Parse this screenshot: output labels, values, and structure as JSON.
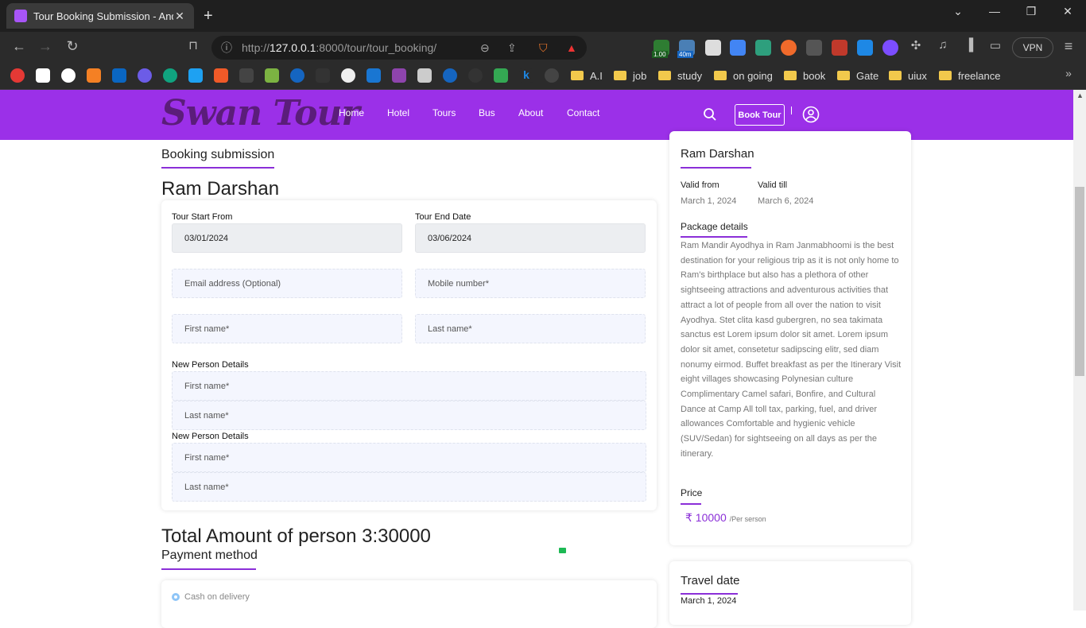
{
  "browser": {
    "tab_title": "Tour Booking Submission - Andt",
    "url_prefix": "http://",
    "url_host": "127.0.0.1",
    "url_rest": ":8000/tour/tour_booking/",
    "vpn_label": "VPN",
    "ext_badge_1": "1.00",
    "ext_badge_2": "40m",
    "bookmarks": [
      "A.I",
      "job",
      "study",
      "on going",
      "book",
      "Gate",
      "uiux",
      "freelance"
    ]
  },
  "site": {
    "logo": "Swan Tour",
    "nav": [
      "Home",
      "Hotel",
      "Tours",
      "Bus",
      "About",
      "Contact"
    ],
    "book_button": "Book Tour"
  },
  "main": {
    "section_title": "Booking submission",
    "tour_name": "Ram Darshan",
    "start_label": "Tour Start From",
    "start_value": "03/01/2024",
    "end_label": "Tour End Date",
    "end_value": "03/06/2024",
    "email_placeholder": "Email address (Optional)",
    "mobile_placeholder": "Mobile number*",
    "first_placeholder": "First name*",
    "last_placeholder": "Last name*",
    "new_person_label": "New Person Details",
    "total": "Total Amount of person 3:30000",
    "payment_title": "Payment method",
    "cod_label": "Cash on delivery"
  },
  "sidebar": {
    "title": "Ram Darshan",
    "valid_from_label": "Valid from",
    "valid_from": "March 1, 2024",
    "valid_till_label": "Valid till",
    "valid_till": "March 6, 2024",
    "package_label": "Package details",
    "description": "Ram Mandir Ayodhya in Ram Janmabhoomi is the best destination for your religious trip as it is not only home to Ram's birthplace but also has a plethora of other sightseeing attractions and adventurous activities that attract a lot of people from all over the nation to visit Ayodhya. Stet clita kasd gubergren, no sea takimata sanctus est Lorem ipsum dolor sit amet. Lorem ipsum dolor sit amet, consetetur sadipscing elitr, sed diam nonumy eirmod. Buffet breakfast as per the Itinerary Visit eight villages showcasing Polynesian culture Complimentary Camel safari, Bonfire, and Cultural Dance at Camp All toll tax, parking, fuel, and driver allowances Comfortable and hygienic vehicle (SUV/Sedan) for sightseeing on all days as per the itinerary.",
    "price_label": "Price",
    "price": "₹ 10000",
    "price_unit": "/Per serson",
    "travel_date_label": "Travel date",
    "travel_date": "March 1, 2024"
  },
  "colors": {
    "brand": "#9b30e8",
    "accent": "#8b2fd8"
  }
}
